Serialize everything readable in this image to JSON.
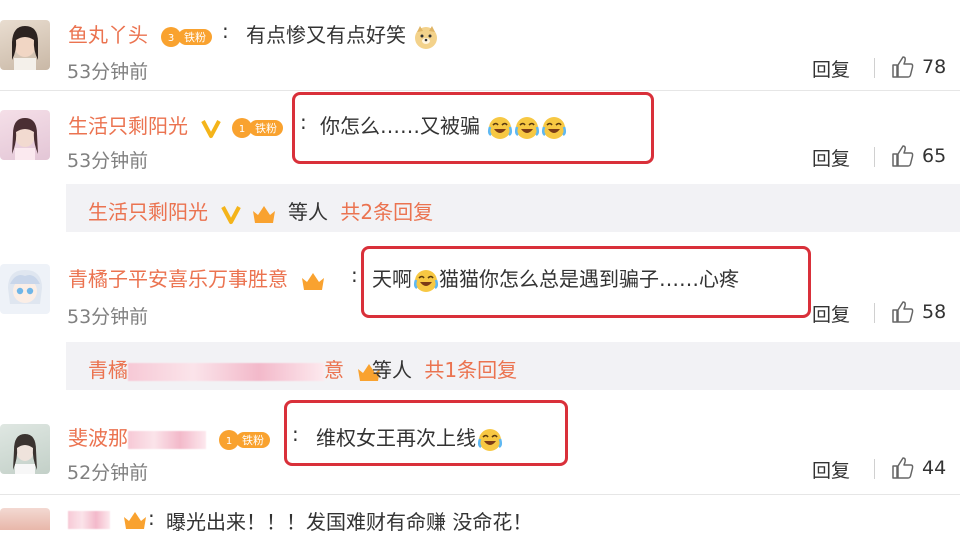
{
  "comments": [
    {
      "username": "鱼丸丫头",
      "badge": "铁粉",
      "text": "有点惨又有点好笑",
      "emoji": "doge-icon",
      "time": "53分钟前",
      "reply": "回复",
      "likes": "78"
    },
    {
      "username": "生活只剩阳光",
      "badge": "铁粉",
      "text": "你怎么……又被骗",
      "emoji": "laughing-crying-icon",
      "time": "53分钟前",
      "reply": "回复",
      "likes": "65",
      "sub": {
        "name": "生活只剩阳光",
        "tail_a": "等人",
        "tail_b": "共2条回复"
      }
    },
    {
      "username": "青橘子平安喜乐万事胜意",
      "text_a": "天啊",
      "text_b": "猫猫你怎么总是遇到骗子……心疼",
      "time": "53分钟前",
      "reply": "回复",
      "likes": "58",
      "sub": {
        "name_a": "青橘",
        "name_b": "意",
        "tail_a": "等人",
        "tail_b": "共1条回复"
      }
    },
    {
      "username": "斐波那",
      "badge": "铁粉",
      "text": "维权女王再次上线",
      "time": "52分钟前",
      "reply": "回复",
      "likes": "44"
    },
    {
      "text": "曝光出来！！！发国难财有命赚 没命花！"
    }
  ],
  "colors": {
    "username": "#eb7350",
    "highlight_box": "#d9303a",
    "meta": "#808080"
  }
}
